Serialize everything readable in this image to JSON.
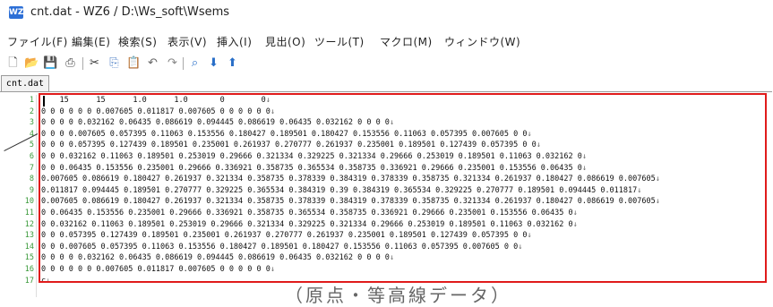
{
  "window": {
    "title": "cnt.dat - WZ6 / D:\\Ws_soft\\Wsems",
    "app_icon_label": "WZ"
  },
  "menu": [
    "ファイル(F)",
    "編集(E)",
    "検索(S)",
    "表示(V)",
    "挿入(I)",
    "見出(O)",
    "ツール(T)",
    "マクロ(M)",
    "ウィンドウ(W)"
  ],
  "toolbar": {
    "icons": [
      "new-file-icon",
      "open-folder-icon",
      "save-icon",
      "print-icon",
      "cut-icon",
      "copy-icon",
      "paste-icon",
      "undo-icon",
      "redo-icon",
      "search-icon",
      "down-arrow-icon",
      "up-arrow-icon"
    ]
  },
  "tab": {
    "label": "cnt.dat"
  },
  "editor": {
    "eol_mark": "↓",
    "line_numbers": [
      "1",
      "2",
      "3",
      "4",
      "5",
      "6",
      "7",
      "8",
      "9",
      "10",
      "11",
      "12",
      "13",
      "14",
      "15",
      "16",
      "17"
    ],
    "lines": [
      "    15      15      1.0      1.0       0        0",
      "0 0 0 0 0 0 0.007605 0.011817 0.007605 0 0 0 0 0 0",
      "0 0 0 0 0.032162 0.06435 0.086619 0.094445 0.086619 0.06435 0.032162 0 0 0 0",
      "0 0 0 0.007605 0.057395 0.11063 0.153556 0.180427 0.189501 0.180427 0.153556 0.11063 0.057395 0.007605 0 0",
      "0 0 0 0.057395 0.127439 0.189501 0.235001 0.261937 0.270777 0.261937 0.235001 0.189501 0.127439 0.057395 0 0",
      "0 0 0.032162 0.11063 0.189501 0.253019 0.29666 0.321334 0.329225 0.321334 0.29666 0.253019 0.189501 0.11063 0.032162 0",
      "0 0 0.06435 0.153556 0.235001 0.29666 0.336921 0.358735 0.365534 0.358735 0.336921 0.29666 0.235001 0.153556 0.06435 0",
      "0.007605 0.086619 0.180427 0.261937 0.321334 0.358735 0.378339 0.384319 0.378339 0.358735 0.321334 0.261937 0.180427 0.086619 0.007605",
      "0.011817 0.094445 0.189501 0.270777 0.329225 0.365534 0.384319 0.39 0.384319 0.365534 0.329225 0.270777 0.189501 0.094445 0.011817",
      "0.007605 0.086619 0.180427 0.261937 0.321334 0.358735 0.378339 0.384319 0.378339 0.358735 0.321334 0.261937 0.180427 0.086619 0.007605",
      "0 0.06435 0.153556 0.235001 0.29666 0.336921 0.358735 0.365534 0.358735 0.336921 0.29666 0.235001 0.153556 0.06435 0",
      "0 0.032162 0.11063 0.189501 0.253019 0.29666 0.321334 0.329225 0.321334 0.29666 0.253019 0.189501 0.11063 0.032162 0",
      "0 0 0.057395 0.127439 0.189501 0.235001 0.261937 0.270777 0.261937 0.235001 0.189501 0.127439 0.057395 0 0",
      "0 0 0.007605 0.057395 0.11063 0.153556 0.180427 0.189501 0.180427 0.153556 0.11063 0.057395 0.007605 0 0",
      "0 0 0 0 0.032162 0.06435 0.086619 0.094445 0.086619 0.06435 0.032162 0 0 0 0",
      "0 0 0 0 0 0 0.007605 0.011817 0.007605 0 0 0 0 0 0",
      "c"
    ]
  },
  "caption": "（原点・等高線データ）",
  "colors": {
    "highlight_box": "#e01b1b",
    "line_number": "#3a9a3a",
    "app_icon": "#2d6fd6"
  }
}
